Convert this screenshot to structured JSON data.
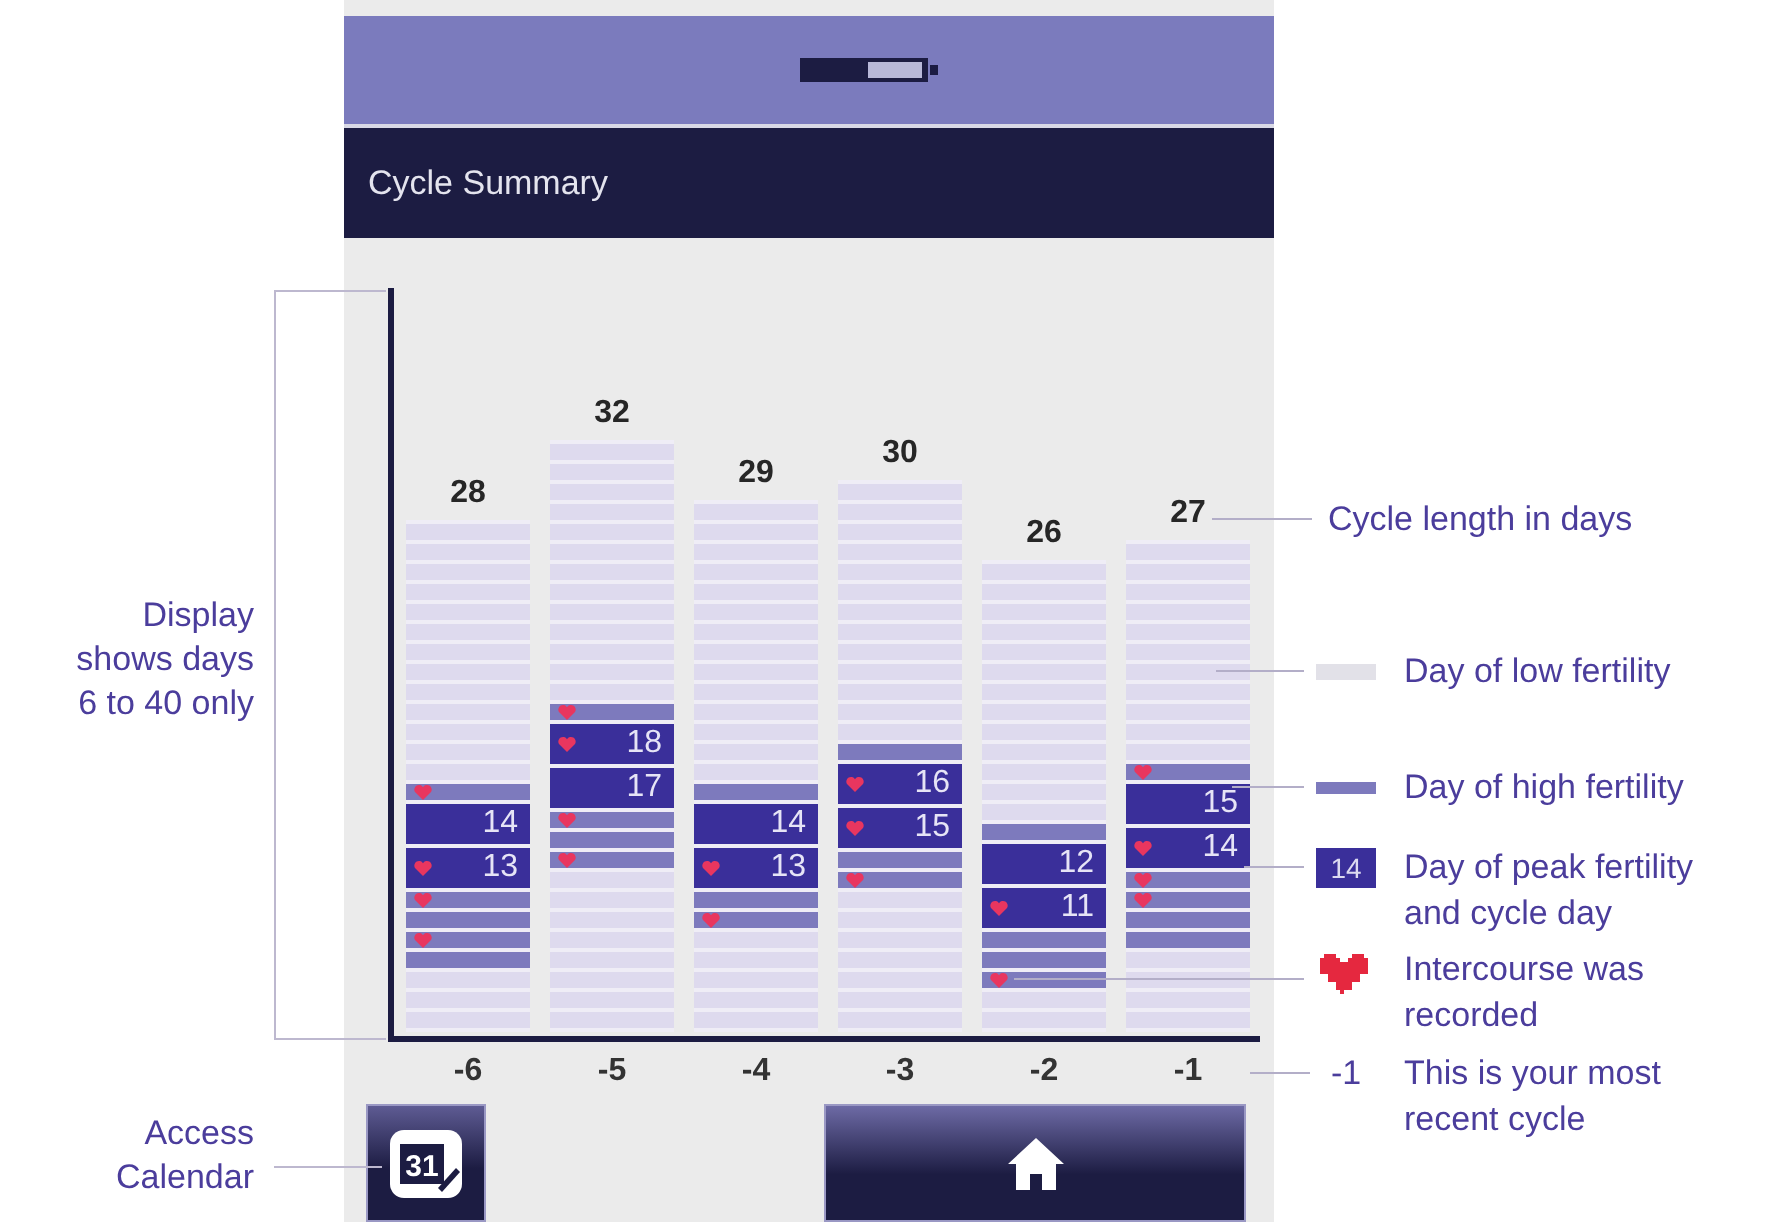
{
  "notes": [
    {
      "kind": "range",
      "text": "Display shows days 6 to 40 only"
    },
    {
      "kind": "calendar",
      "text": "Access Calendar"
    }
  ],
  "screen": {
    "title": "Cycle Summary",
    "cycles": [
      {
        "label": "-6",
        "length": "28",
        "days": [
          {
            "kind": "low",
            "intercourse": false
          },
          {
            "kind": "low",
            "intercourse": false
          },
          {
            "kind": "low",
            "intercourse": false
          },
          {
            "kind": "low",
            "intercourse": false
          },
          {
            "kind": "low",
            "intercourse": false
          },
          {
            "kind": "low",
            "intercourse": false
          },
          {
            "kind": "low",
            "intercourse": false
          },
          {
            "kind": "low",
            "intercourse": false
          },
          {
            "kind": "low",
            "intercourse": false
          },
          {
            "kind": "low",
            "intercourse": false
          },
          {
            "kind": "low",
            "intercourse": false
          },
          {
            "kind": "low",
            "intercourse": false
          },
          {
            "kind": "low",
            "intercourse": false
          },
          {
            "kind": "high",
            "intercourse": true
          },
          {
            "kind": "peak",
            "day": "14",
            "intercourse": false
          },
          {
            "kind": "peak",
            "day": "13",
            "intercourse": true
          },
          {
            "kind": "high",
            "intercourse": true
          },
          {
            "kind": "high",
            "intercourse": false
          },
          {
            "kind": "high",
            "intercourse": true
          },
          {
            "kind": "high",
            "intercourse": false
          },
          {
            "kind": "low",
            "intercourse": false
          },
          {
            "kind": "low",
            "intercourse": false
          },
          {
            "kind": "low",
            "intercourse": false
          }
        ]
      },
      {
        "label": "-5",
        "length": "32",
        "days": [
          {
            "kind": "low",
            "intercourse": false
          },
          {
            "kind": "low",
            "intercourse": false
          },
          {
            "kind": "low",
            "intercourse": false
          },
          {
            "kind": "low",
            "intercourse": false
          },
          {
            "kind": "low",
            "intercourse": false
          },
          {
            "kind": "low",
            "intercourse": false
          },
          {
            "kind": "low",
            "intercourse": false
          },
          {
            "kind": "low",
            "intercourse": false
          },
          {
            "kind": "low",
            "intercourse": false
          },
          {
            "kind": "low",
            "intercourse": false
          },
          {
            "kind": "low",
            "intercourse": false
          },
          {
            "kind": "low",
            "intercourse": false
          },
          {
            "kind": "low",
            "intercourse": false
          },
          {
            "kind": "high",
            "intercourse": true
          },
          {
            "kind": "peak",
            "day": "18",
            "intercourse": true
          },
          {
            "kind": "peak",
            "day": "17",
            "intercourse": false
          },
          {
            "kind": "high",
            "intercourse": true
          },
          {
            "kind": "high",
            "intercourse": false
          },
          {
            "kind": "high",
            "intercourse": true
          },
          {
            "kind": "low",
            "intercourse": false
          },
          {
            "kind": "low",
            "intercourse": false
          },
          {
            "kind": "low",
            "intercourse": false
          },
          {
            "kind": "low",
            "intercourse": false
          },
          {
            "kind": "low",
            "intercourse": false
          },
          {
            "kind": "low",
            "intercourse": false
          },
          {
            "kind": "low",
            "intercourse": false
          },
          {
            "kind": "low",
            "intercourse": false
          }
        ]
      },
      {
        "label": "-4",
        "length": "29",
        "days": [
          {
            "kind": "low",
            "intercourse": false
          },
          {
            "kind": "low",
            "intercourse": false
          },
          {
            "kind": "low",
            "intercourse": false
          },
          {
            "kind": "low",
            "intercourse": false
          },
          {
            "kind": "low",
            "intercourse": false
          },
          {
            "kind": "low",
            "intercourse": false
          },
          {
            "kind": "low",
            "intercourse": false
          },
          {
            "kind": "low",
            "intercourse": false
          },
          {
            "kind": "low",
            "intercourse": false
          },
          {
            "kind": "low",
            "intercourse": false
          },
          {
            "kind": "low",
            "intercourse": false
          },
          {
            "kind": "low",
            "intercourse": false
          },
          {
            "kind": "low",
            "intercourse": false
          },
          {
            "kind": "low",
            "intercourse": false
          },
          {
            "kind": "high",
            "intercourse": false
          },
          {
            "kind": "peak",
            "day": "14",
            "intercourse": false
          },
          {
            "kind": "peak",
            "day": "13",
            "intercourse": true
          },
          {
            "kind": "high",
            "intercourse": false
          },
          {
            "kind": "high",
            "intercourse": true
          },
          {
            "kind": "low",
            "intercourse": false
          },
          {
            "kind": "low",
            "intercourse": false
          },
          {
            "kind": "low",
            "intercourse": false
          },
          {
            "kind": "low",
            "intercourse": false
          },
          {
            "kind": "low",
            "intercourse": false
          }
        ]
      },
      {
        "label": "-3",
        "length": "30",
        "days": [
          {
            "kind": "low",
            "intercourse": false
          },
          {
            "kind": "low",
            "intercourse": false
          },
          {
            "kind": "low",
            "intercourse": false
          },
          {
            "kind": "low",
            "intercourse": false
          },
          {
            "kind": "low",
            "intercourse": false
          },
          {
            "kind": "low",
            "intercourse": false
          },
          {
            "kind": "low",
            "intercourse": false
          },
          {
            "kind": "low",
            "intercourse": false
          },
          {
            "kind": "low",
            "intercourse": false
          },
          {
            "kind": "low",
            "intercourse": false
          },
          {
            "kind": "low",
            "intercourse": false
          },
          {
            "kind": "low",
            "intercourse": false
          },
          {
            "kind": "low",
            "intercourse": false
          },
          {
            "kind": "high",
            "intercourse": false
          },
          {
            "kind": "peak",
            "day": "16",
            "intercourse": true
          },
          {
            "kind": "peak",
            "day": "15",
            "intercourse": true
          },
          {
            "kind": "high",
            "intercourse": false
          },
          {
            "kind": "high",
            "intercourse": true
          },
          {
            "kind": "low",
            "intercourse": false
          },
          {
            "kind": "low",
            "intercourse": false
          },
          {
            "kind": "low",
            "intercourse": false
          },
          {
            "kind": "low",
            "intercourse": false
          },
          {
            "kind": "low",
            "intercourse": false
          },
          {
            "kind": "low",
            "intercourse": false
          },
          {
            "kind": "low",
            "intercourse": false
          }
        ]
      },
      {
        "label": "-2",
        "length": "26",
        "days": [
          {
            "kind": "low",
            "intercourse": false
          },
          {
            "kind": "low",
            "intercourse": false
          },
          {
            "kind": "low",
            "intercourse": false
          },
          {
            "kind": "low",
            "intercourse": false
          },
          {
            "kind": "low",
            "intercourse": false
          },
          {
            "kind": "low",
            "intercourse": false
          },
          {
            "kind": "low",
            "intercourse": false
          },
          {
            "kind": "low",
            "intercourse": false
          },
          {
            "kind": "low",
            "intercourse": false
          },
          {
            "kind": "low",
            "intercourse": false
          },
          {
            "kind": "low",
            "intercourse": false
          },
          {
            "kind": "low",
            "intercourse": false
          },
          {
            "kind": "low",
            "intercourse": false
          },
          {
            "kind": "high",
            "intercourse": false
          },
          {
            "kind": "peak",
            "day": "12",
            "intercourse": false
          },
          {
            "kind": "peak",
            "day": "11",
            "intercourse": true
          },
          {
            "kind": "high",
            "intercourse": false
          },
          {
            "kind": "high",
            "intercourse": false
          },
          {
            "kind": "high",
            "intercourse": true
          },
          {
            "kind": "low",
            "intercourse": false
          },
          {
            "kind": "low",
            "intercourse": false
          }
        ]
      },
      {
        "label": "-1",
        "length": "27",
        "days": [
          {
            "kind": "low",
            "intercourse": false
          },
          {
            "kind": "low",
            "intercourse": false
          },
          {
            "kind": "low",
            "intercourse": false
          },
          {
            "kind": "low",
            "intercourse": false
          },
          {
            "kind": "low",
            "intercourse": false
          },
          {
            "kind": "low",
            "intercourse": false
          },
          {
            "kind": "low",
            "intercourse": false
          },
          {
            "kind": "low",
            "intercourse": false
          },
          {
            "kind": "low",
            "intercourse": false
          },
          {
            "kind": "low",
            "intercourse": false
          },
          {
            "kind": "low",
            "intercourse": false
          },
          {
            "kind": "high",
            "intercourse": true
          },
          {
            "kind": "peak",
            "day": "15",
            "intercourse": false
          },
          {
            "kind": "peak",
            "day": "14",
            "intercourse": true
          },
          {
            "kind": "high",
            "intercourse": true
          },
          {
            "kind": "high",
            "intercourse": true
          },
          {
            "kind": "high",
            "intercourse": false
          },
          {
            "kind": "high",
            "intercourse": false
          },
          {
            "kind": "low",
            "intercourse": false
          },
          {
            "kind": "low",
            "intercourse": false
          },
          {
            "kind": "low",
            "intercourse": false
          },
          {
            "kind": "low",
            "intercourse": false
          }
        ]
      }
    ],
    "calendar_button": {
      "label": "31"
    }
  },
  "legend": [
    {
      "kind": "length",
      "text": "Cycle length in days"
    },
    {
      "kind": "low",
      "text": "Day of low fertility"
    },
    {
      "kind": "high",
      "text": "Day of high fertility"
    },
    {
      "kind": "peak",
      "swatch": "14",
      "text": "Day of peak fertility and cycle day"
    },
    {
      "kind": "intercourse",
      "text": "Intercourse was recorded"
    },
    {
      "kind": "recent",
      "swatch": "-1",
      "text": "This is your most recent cycle"
    }
  ]
}
